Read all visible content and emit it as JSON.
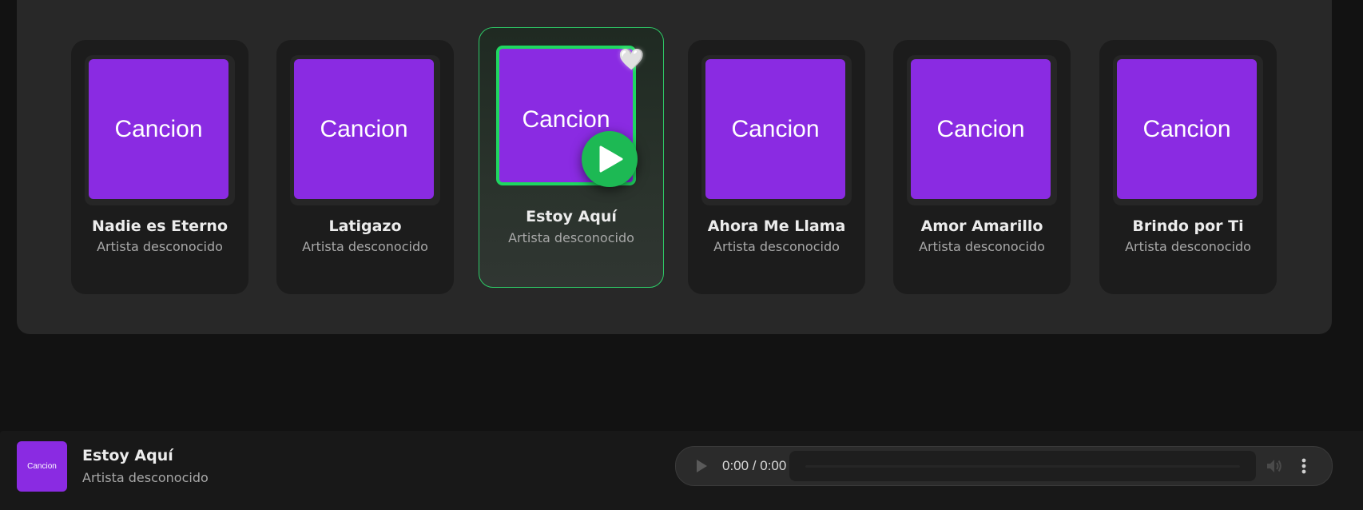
{
  "cards_top_row_count": 6,
  "cards": [
    {
      "art_label": "Cancion",
      "title": "Nadie es Eterno",
      "artist": "Artista desconocido"
    },
    {
      "art_label": "Cancion",
      "title": "Latigazo",
      "artist": "Artista desconocido"
    },
    {
      "art_label": "Cancion",
      "title": "Estoy Aquí",
      "artist": "Artista desconocido",
      "active": true
    },
    {
      "art_label": "Cancion",
      "title": "Ahora Me Llama",
      "artist": "Artista desconocido"
    },
    {
      "art_label": "Cancion",
      "title": "Amor Amarillo",
      "artist": "Artista desconocido"
    },
    {
      "art_label": "Cancion",
      "title": "Brindo por Ti",
      "artist": "Artista desconocido"
    }
  ],
  "player": {
    "thumb_label": "Cancion",
    "title": "Estoy Aquí",
    "artist": "Artista desconocido",
    "time": "0:00 / 0:00"
  },
  "colors": {
    "accent": "#1db954",
    "art": "#8a2be2"
  },
  "icons": {
    "favorite": "heart-icon",
    "play": "play-icon",
    "volume": "volume-icon",
    "more": "more-vertical-icon"
  }
}
